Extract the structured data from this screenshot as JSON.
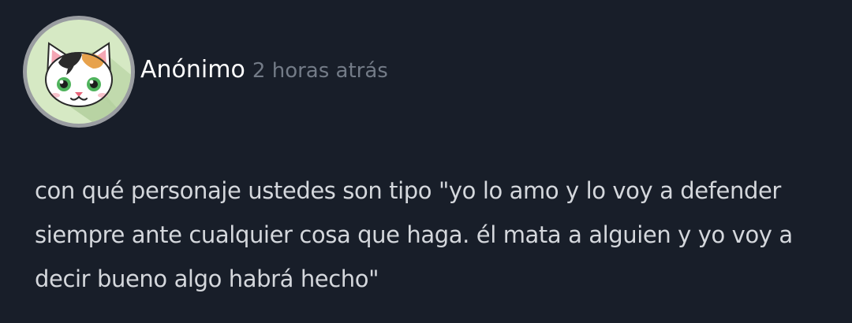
{
  "post": {
    "author": "Anónimo",
    "time_ago": "2 horas atrás",
    "body": "con qué personaje ustedes son tipo \"yo lo amo y lo voy a defender siempre ante cualquier cosa que haga. él mata a alguien y yo voy a decir bueno algo habrá hecho\""
  },
  "avatar": {
    "icon": "calico-cat-avatar",
    "ring_color": "#9a9da1",
    "background_color": "#d6e9c4"
  },
  "colors": {
    "page_background": "#181e29",
    "author": "#ffffff",
    "timestamp": "#737b87",
    "body_text": "#d4d7dc"
  }
}
